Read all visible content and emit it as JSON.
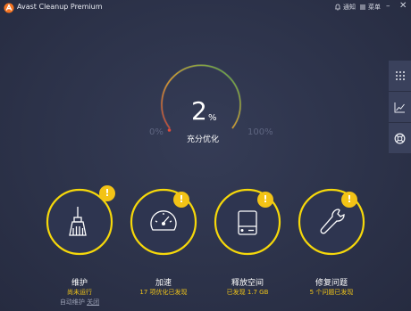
{
  "window": {
    "title": "Avast Cleanup Premium",
    "notifications_label": "通知",
    "menu_label": "菜单",
    "minimize_glyph": "–",
    "close_glyph": "✕"
  },
  "gauge": {
    "value": "2",
    "unit": "%",
    "label": "充分优化",
    "min_label": "0%",
    "max_label": "100%",
    "level": 0.02
  },
  "sidebar": {
    "items": [
      {
        "icon": "grid-icon"
      },
      {
        "icon": "chart-icon"
      },
      {
        "icon": "lifebuoy-icon"
      }
    ]
  },
  "tiles": [
    {
      "label": "维护",
      "status": "尚未运行",
      "sub_prefix": "自动维护 ",
      "sub_link": "关闭",
      "icon": "broom-icon",
      "badge": "!"
    },
    {
      "label": "加速",
      "status": "17 项优化已发现",
      "icon": "speedometer-icon",
      "badge": "!"
    },
    {
      "label": "释放空间",
      "status": "已发现 1.7 GB",
      "icon": "hard-drive-icon",
      "badge": "!"
    },
    {
      "label": "修复问题",
      "status": "5 个问题已发现",
      "icon": "wrench-icon",
      "badge": "!"
    }
  ],
  "colors": {
    "accent_yellow": "#f6d80a",
    "badge_yellow": "#f3c316",
    "status_yellow": "#f0c419",
    "background": "#2c3249",
    "tile_fill": "#2e3550"
  }
}
